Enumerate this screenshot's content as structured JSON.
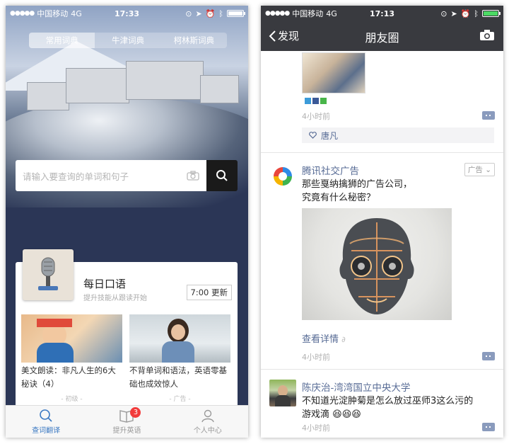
{
  "left": {
    "status": {
      "carrier": "中国移动",
      "network": "4G",
      "time": "17:33"
    },
    "dict_tabs": [
      "常用词典",
      "牛津词典",
      "柯林斯词典"
    ],
    "search": {
      "placeholder": "请输入要查询的单词和句子"
    },
    "daily": {
      "title": "每日口语",
      "subtitle": "提升技能从跟读开始",
      "update_label": "7:00 更新",
      "items": [
        {
          "caption": "美文朗读：非凡人生的6大秘诀（4）",
          "tag": "- 初级 -"
        },
        {
          "caption": "不背单词和语法，英语零基础也成效惊人",
          "tag": "- 广告 -"
        }
      ]
    },
    "tabbar": [
      {
        "label": "查词翻译",
        "icon": "search-icon",
        "active": true
      },
      {
        "label": "提升英语",
        "icon": "book-icon",
        "badge": "3"
      },
      {
        "label": "个人中心",
        "icon": "person-icon"
      }
    ]
  },
  "right": {
    "status": {
      "carrier": "中国移动",
      "network": "4G",
      "time": "17:13"
    },
    "nav": {
      "back_label": "发现",
      "title": "朋友圈"
    },
    "posts": [
      {
        "time": "4小时前",
        "likes": "唐凡"
      },
      {
        "name": "腾讯社交广告",
        "ad_tag": "广告",
        "text_line1": "那些戛纳擒狮的广告公司，",
        "text_line2": "究竟有什么秘密？",
        "link": "查看详情",
        "time": "4小时前"
      },
      {
        "name": "陈庆治-湾湾国立中央大学",
        "text_line1": "不知道光淀肿菊是怎么放过巫师3这么污的",
        "text_line2": "游戏滴",
        "time": "4小时前"
      }
    ]
  },
  "colors": {
    "link": "#576b95",
    "nav": "#393a3f",
    "accent": "#3a78c2",
    "badge": "#f23b3b"
  }
}
